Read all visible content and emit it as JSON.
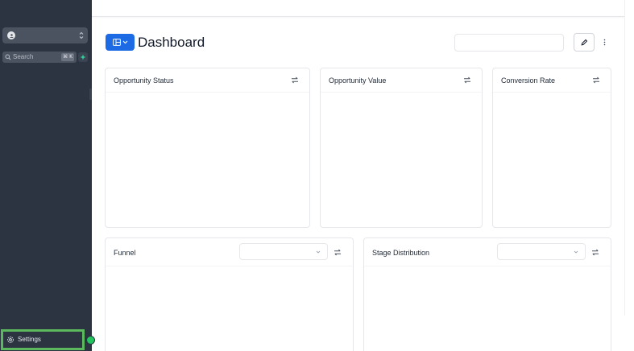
{
  "sidebar": {
    "workspace_name": "",
    "search_label": "Search",
    "search_shortcut": "⌘ K",
    "settings_label": "Settings",
    "settings_icon": "gear-icon",
    "ai_icon": "sparkle-icon"
  },
  "header": {
    "title": "Dashboard",
    "view_switcher_icon": "layout-icon",
    "date_filter_value": "",
    "edit_icon": "pencil-icon",
    "more_icon": "more-vertical-icon"
  },
  "cards": [
    {
      "title": "Opportunity Status",
      "icon": "swap-icon"
    },
    {
      "title": "Opportunity Value",
      "icon": "swap-icon"
    },
    {
      "title": "Conversion Rate",
      "icon": "swap-icon"
    },
    {
      "title": "Funnel",
      "icon": "swap-icon",
      "select_value": ""
    },
    {
      "title": "Stage Distribution",
      "icon": "swap-icon",
      "select_value": ""
    }
  ],
  "colors": {
    "sidebar_bg": "#2c3441",
    "accent_blue": "#1d6ae5",
    "highlight_green": "#5cb85c",
    "status_green": "#22c55e"
  }
}
